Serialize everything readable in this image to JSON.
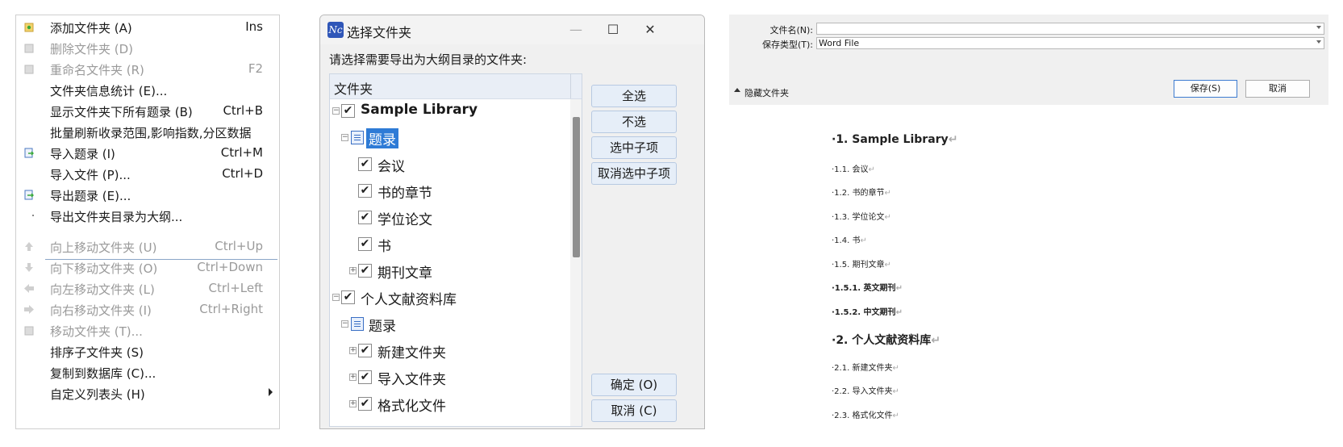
{
  "menu": {
    "items": [
      {
        "label": "添加文件夹 (A)",
        "shortcut": "Ins",
        "disabled": false,
        "icon": "folder-add-icon"
      },
      {
        "label": "删除文件夹 (D)",
        "shortcut": "",
        "disabled": true,
        "icon": "folder-delete-icon"
      },
      {
        "label": "重命名文件夹 (R)",
        "shortcut": "F2",
        "disabled": true,
        "icon": "folder-rename-icon"
      },
      {
        "label": "文件夹信息统计 (E)...",
        "shortcut": "",
        "disabled": false,
        "icon": ""
      },
      {
        "label": "显示文件夹下所有题录 (B)",
        "shortcut": "Ctrl+B",
        "disabled": false,
        "icon": ""
      },
      {
        "label": "批量刷新收录范围,影响指数,分区数据",
        "shortcut": "",
        "disabled": false,
        "icon": ""
      },
      {
        "label": "导入题录 (I)",
        "shortcut": "Ctrl+M",
        "disabled": false,
        "icon": "import-records-icon"
      },
      {
        "label": "导入文件 (P)...",
        "shortcut": "Ctrl+D",
        "disabled": false,
        "icon": ""
      },
      {
        "label": "导出题录 (E)...",
        "shortcut": "",
        "disabled": false,
        "icon": "export-records-icon"
      },
      {
        "label": "导出文件夹目录为大纲...",
        "shortcut": "",
        "disabled": false,
        "icon": "dot"
      },
      {
        "label": "向上移动文件夹 (U)",
        "shortcut": "Ctrl+Up",
        "disabled": true,
        "icon": "arrow-up-icon"
      },
      {
        "label": "向下移动文件夹 (O)",
        "shortcut": "Ctrl+Down",
        "disabled": true,
        "icon": "arrow-down-icon"
      },
      {
        "label": "向左移动文件夹 (L)",
        "shortcut": "Ctrl+Left",
        "disabled": true,
        "icon": "arrow-left-icon"
      },
      {
        "label": "向右移动文件夹 (I)",
        "shortcut": "Ctrl+Right",
        "disabled": true,
        "icon": "arrow-right-icon"
      },
      {
        "label": "移动文件夹 (T)...",
        "shortcut": "",
        "disabled": true,
        "icon": "folder-move-icon"
      },
      {
        "label": "排序子文件夹 (S)",
        "shortcut": "",
        "disabled": false,
        "icon": ""
      },
      {
        "label": "复制到数据库 (C)...",
        "shortcut": "",
        "disabled": false,
        "icon": ""
      },
      {
        "label": "自定义列表头 (H)",
        "shortcut": "",
        "disabled": false,
        "icon": "",
        "submenu": true
      }
    ]
  },
  "dialog": {
    "title": "选择文件夹",
    "logo_text": "Nc",
    "min_glyph": "—",
    "max_glyph": "☐",
    "close_glyph": "✕",
    "prompt": "请选择需要导出为大纲目录的文件夹:",
    "tree_header": "文件夹",
    "tree": [
      {
        "label": "Sample Library",
        "expander": "−",
        "check": true,
        "bold": true
      },
      {
        "label": "题录",
        "expander": "−",
        "list_icon": true,
        "selected": true
      },
      {
        "label": "会议",
        "check": true
      },
      {
        "label": "书的章节",
        "check": true
      },
      {
        "label": "学位论文",
        "check": true
      },
      {
        "label": "书",
        "check": true
      },
      {
        "label": "期刊文章",
        "expander": "+",
        "check": true
      },
      {
        "label": "个人文献资料库",
        "expander": "−",
        "check": true
      },
      {
        "label": "题录",
        "expander": "−",
        "list_icon": true
      },
      {
        "label": "新建文件夹",
        "expander": "+",
        "check": true
      },
      {
        "label": "导入文件夹",
        "expander": "+",
        "check": true
      },
      {
        "label": "格式化文件",
        "expander": "+",
        "check": true
      }
    ],
    "buttons": {
      "select_all": "全选",
      "select_none": "不选",
      "select_children": "选中子项",
      "deselect_children": "取消选中子项",
      "ok": "确定 (O)",
      "cancel": "取消 (C)"
    },
    "check_glyph": "✔"
  },
  "save": {
    "filename_label": "文件名(N):",
    "filename_value": "",
    "type_label": "保存类型(T):",
    "type_value": "Word File",
    "hide_folders": "隐藏文件夹",
    "save_button": "保存(S)",
    "cancel_button": "取消"
  },
  "outline": [
    {
      "text": "·1. Sample Library",
      "level": 1
    },
    {
      "text": "·1.1. 会议",
      "level": 2
    },
    {
      "text": "·1.2. 书的章节",
      "level": 2
    },
    {
      "text": "·1.3. 学位论文",
      "level": 2
    },
    {
      "text": "·1.4. 书",
      "level": 2
    },
    {
      "text": "·1.5. 期刊文章",
      "level": 2
    },
    {
      "text": "·1.5.1. 英文期刊",
      "level": 3
    },
    {
      "text": "·1.5.2. 中文期刊",
      "level": 3
    },
    {
      "text": "·2. 个人文献资料库",
      "level": 1
    },
    {
      "text": "·2.1. 新建文件夹",
      "level": 2
    },
    {
      "text": "·2.2. 导入文件夹",
      "level": 2
    },
    {
      "text": "·2.3. 格式化文件",
      "level": 2
    }
  ],
  "paragraph_mark": "↵",
  "colors": {
    "selection": "#2e7bd6",
    "button_bg": "#e6eef8",
    "separator": "#8aa6c8"
  }
}
